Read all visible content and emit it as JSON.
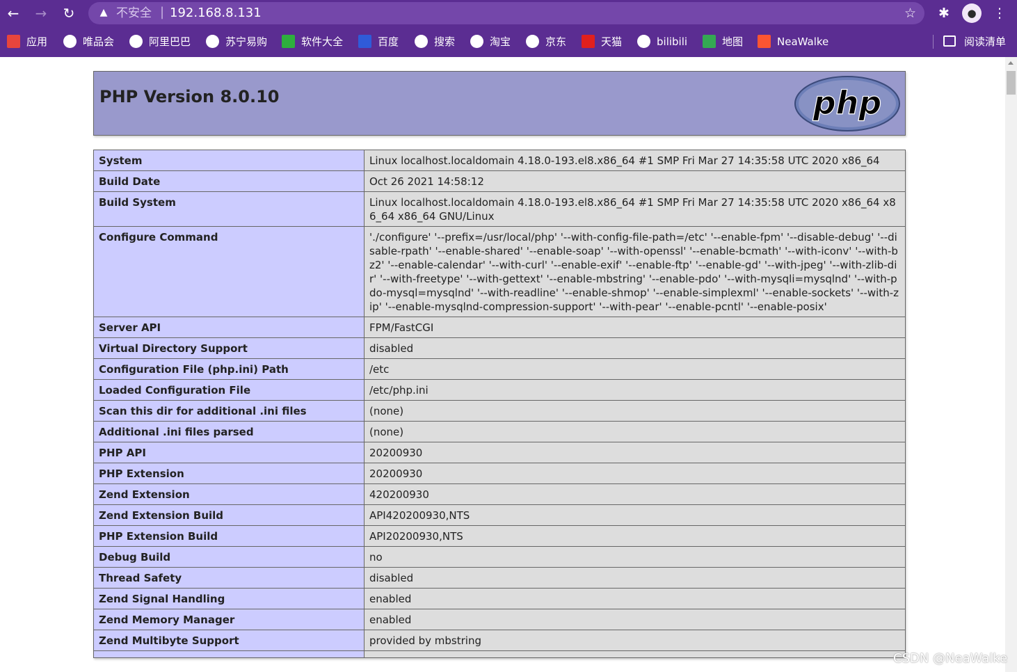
{
  "browser": {
    "security_label": "不安全",
    "url": "192.168.8.131",
    "separator": "|",
    "bookmarks": [
      {
        "label": "应用",
        "icon": "apps-grid-icon",
        "color": "#e8453c"
      },
      {
        "label": "唯品会",
        "icon": "globe-icon",
        "color": "#ffffff"
      },
      {
        "label": "阿里巴巴",
        "icon": "globe-icon",
        "color": "#ffffff"
      },
      {
        "label": "苏宁易购",
        "icon": "globe-icon",
        "color": "#ffffff"
      },
      {
        "label": "软件大全",
        "icon": "download-icon",
        "color": "#2eae3d"
      },
      {
        "label": "百度",
        "icon": "baidu-paw-icon",
        "color": "#2f5bd9"
      },
      {
        "label": "搜索",
        "icon": "globe-icon",
        "color": "#ffffff"
      },
      {
        "label": "淘宝",
        "icon": "globe-icon",
        "color": "#ffffff"
      },
      {
        "label": "京东",
        "icon": "globe-icon",
        "color": "#ffffff"
      },
      {
        "label": "天猫",
        "icon": "tmall-icon",
        "color": "#e1201d"
      },
      {
        "label": "bilibili",
        "icon": "globe-icon",
        "color": "#ffffff"
      },
      {
        "label": "地图",
        "icon": "map-icon",
        "color": "#34a853"
      },
      {
        "label": "NeaWalke",
        "icon": "csdn-c-icon",
        "color": "#fc5531"
      }
    ],
    "reading_list_label": "阅读清单",
    "accent_color": "#5b2d92"
  },
  "page": {
    "title": "PHP Version 8.0.10",
    "logo_text": "php",
    "rows": [
      {
        "key": "System",
        "value": "Linux localhost.localdomain 4.18.0-193.el8.x86_64 #1 SMP Fri Mar 27 14:35:58 UTC 2020 x86_64"
      },
      {
        "key": "Build Date",
        "value": "Oct 26 2021 14:58:12"
      },
      {
        "key": "Build System",
        "value": "Linux localhost.localdomain 4.18.0-193.el8.x86_64 #1 SMP Fri Mar 27 14:35:58 UTC 2020 x86_64 x86_64 x86_64 GNU/Linux"
      },
      {
        "key": "Configure Command",
        "value": "'./configure' '--prefix=/usr/local/php' '--with-config-file-path=/etc' '--enable-fpm' '--disable-debug' '--disable-rpath' '--enable-shared' '--enable-soap' '--with-openssl' '--enable-bcmath' '--with-iconv' '--with-bz2' '--enable-calendar' '--with-curl' '--enable-exif' '--enable-ftp' '--enable-gd' '--with-jpeg' '--with-zlib-dir' '--with-freetype' '--with-gettext' '--enable-mbstring' '--enable-pdo' '--with-mysqli=mysqlnd' '--with-pdo-mysql=mysqlnd' '--with-readline' '--enable-shmop' '--enable-simplexml' '--enable-sockets' '--with-zip' '--enable-mysqlnd-compression-support' '--with-pear' '--enable-pcntl' '--enable-posix'"
      },
      {
        "key": "Server API",
        "value": "FPM/FastCGI"
      },
      {
        "key": "Virtual Directory Support",
        "value": "disabled"
      },
      {
        "key": "Configuration File (php.ini) Path",
        "value": "/etc"
      },
      {
        "key": "Loaded Configuration File",
        "value": "/etc/php.ini"
      },
      {
        "key": "Scan this dir for additional .ini files",
        "value": "(none)"
      },
      {
        "key": "Additional .ini files parsed",
        "value": "(none)"
      },
      {
        "key": "PHP API",
        "value": "20200930"
      },
      {
        "key": "PHP Extension",
        "value": "20200930"
      },
      {
        "key": "Zend Extension",
        "value": "420200930"
      },
      {
        "key": "Zend Extension Build",
        "value": "API420200930,NTS"
      },
      {
        "key": "PHP Extension Build",
        "value": "API20200930,NTS"
      },
      {
        "key": "Debug Build",
        "value": "no"
      },
      {
        "key": "Thread Safety",
        "value": "disabled"
      },
      {
        "key": "Zend Signal Handling",
        "value": "enabled"
      },
      {
        "key": "Zend Memory Manager",
        "value": "enabled"
      },
      {
        "key": "Zend Multibyte Support",
        "value": "provided by mbstring"
      },
      {
        "key": "",
        "value": ""
      }
    ],
    "header_color": "#9999cc",
    "key_cell_color": "#ccccff",
    "value_cell_color": "#dddddd"
  },
  "watermark": "CSDN @NeaWalke"
}
